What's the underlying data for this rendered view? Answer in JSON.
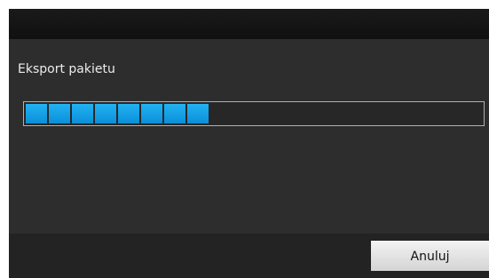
{
  "dialog": {
    "title": "Eksport pakietu",
    "progress": {
      "filled_segments": 8,
      "total_segments": 20,
      "fill_color": "#12a0e6",
      "track_color": "#272727"
    },
    "cancel_label": "Anuluj"
  }
}
